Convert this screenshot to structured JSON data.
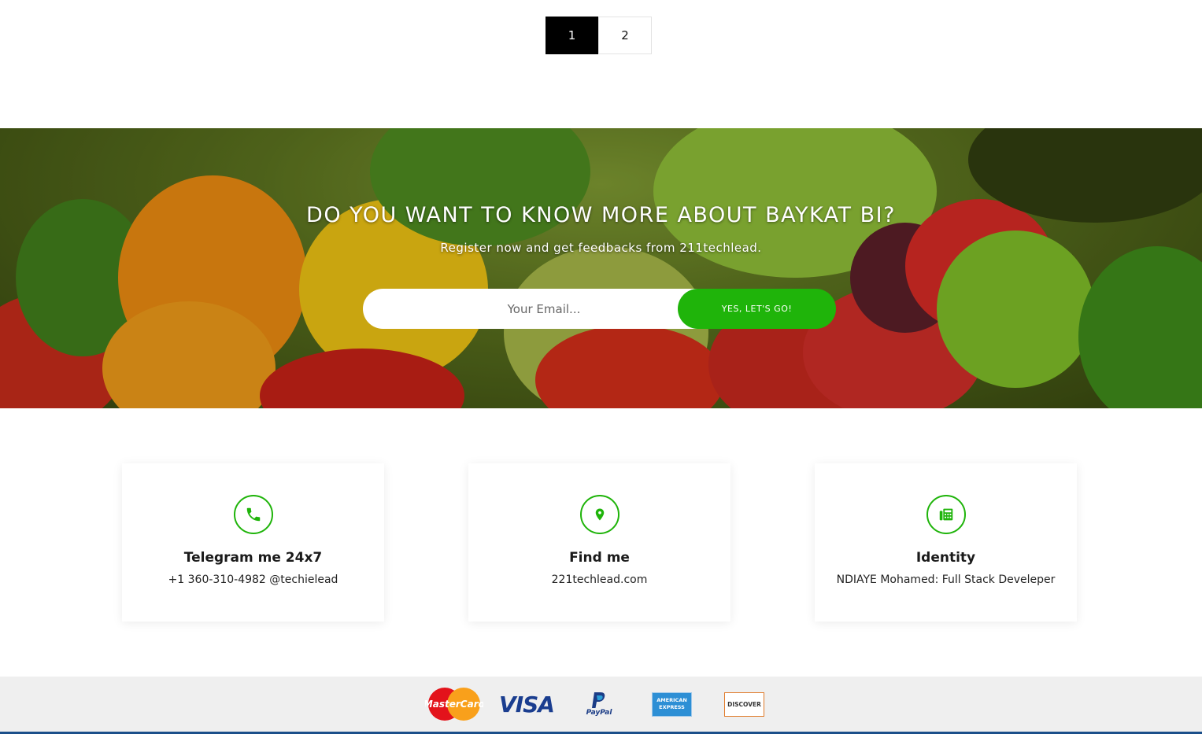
{
  "pagination": {
    "pages": [
      "1",
      "2"
    ],
    "active": "1"
  },
  "banner": {
    "title": "DO YOU WANT TO KNOW MORE ABOUT BAYKAT BI?",
    "subtitle": "Register now and get feedbacks from 211techlead.",
    "email_placeholder": "Your Email...",
    "button_label": "YES, LET'S GO!"
  },
  "contact": {
    "cards": [
      {
        "icon": "phone-icon",
        "title": "Telegram me 24x7",
        "text": "+1 360-310-4982 @techielead"
      },
      {
        "icon": "map-pin-icon",
        "title": "Find me",
        "text": "221techlead.com"
      },
      {
        "icon": "fax-icon",
        "title": "Identity",
        "text": "NDIAYE Mohamed: Full Stack Develeper"
      }
    ]
  },
  "footer": {
    "payment_methods": [
      "MasterCard",
      "VISA",
      "PayPal",
      "AMERICAN EXPRESS",
      "DISCOVER"
    ]
  },
  "colors": {
    "accent": "#1fb40a",
    "footer_bg": "#efefef",
    "footer_bar": "#1b4f8a"
  }
}
